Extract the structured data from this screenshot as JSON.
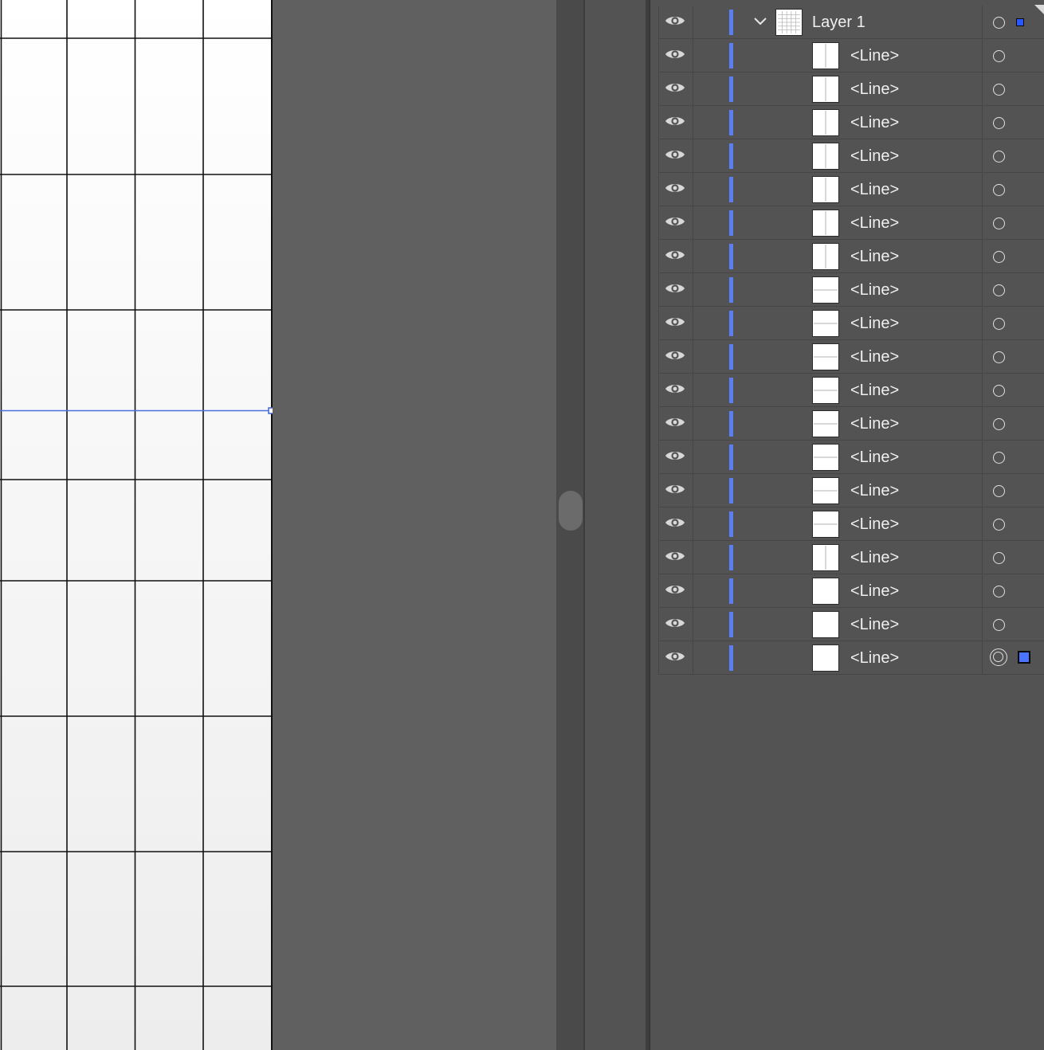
{
  "layers_panel": {
    "parent_layer": {
      "name": "Layer 1",
      "visible": true,
      "expanded": true,
      "has_selected_art": true
    },
    "items": [
      {
        "name": "<Line>",
        "thumb": "vertical",
        "targeted": false,
        "selected": false
      },
      {
        "name": "<Line>",
        "thumb": "vertical",
        "targeted": false,
        "selected": false
      },
      {
        "name": "<Line>",
        "thumb": "vertical",
        "targeted": false,
        "selected": false
      },
      {
        "name": "<Line>",
        "thumb": "vertical",
        "targeted": false,
        "selected": false
      },
      {
        "name": "<Line>",
        "thumb": "vertical",
        "targeted": false,
        "selected": false
      },
      {
        "name": "<Line>",
        "thumb": "vertical",
        "targeted": false,
        "selected": false
      },
      {
        "name": "<Line>",
        "thumb": "vertical",
        "targeted": false,
        "selected": false
      },
      {
        "name": "<Line>",
        "thumb": "horizontal",
        "targeted": false,
        "selected": false
      },
      {
        "name": "<Line>",
        "thumb": "horizontal",
        "targeted": false,
        "selected": false
      },
      {
        "name": "<Line>",
        "thumb": "horizontal",
        "targeted": false,
        "selected": false
      },
      {
        "name": "<Line>",
        "thumb": "horizontal",
        "targeted": false,
        "selected": false
      },
      {
        "name": "<Line>",
        "thumb": "horizontal",
        "targeted": false,
        "selected": false
      },
      {
        "name": "<Line>",
        "thumb": "horizontal",
        "targeted": false,
        "selected": false
      },
      {
        "name": "<Line>",
        "thumb": "horizontal",
        "targeted": false,
        "selected": false
      },
      {
        "name": "<Line>",
        "thumb": "horizontal",
        "targeted": false,
        "selected": false
      },
      {
        "name": "<Line>",
        "thumb": "vertical",
        "targeted": false,
        "selected": false
      },
      {
        "name": "<Line>",
        "thumb": "blank",
        "targeted": false,
        "selected": false
      },
      {
        "name": "<Line>",
        "thumb": "blank",
        "targeted": false,
        "selected": false
      },
      {
        "name": "<Line>",
        "thumb": "blank",
        "targeted": true,
        "selected": true
      }
    ]
  },
  "colors": {
    "panel_background": "#535353",
    "canvas_background": "#606060",
    "layer_color": "#5b7ff0",
    "selection_color": "#4a74ff"
  },
  "icons": {
    "visibility": "eye-icon",
    "expand": "chevron-down-icon",
    "target": "circle-target-icon",
    "selected": "selection-square-icon"
  }
}
